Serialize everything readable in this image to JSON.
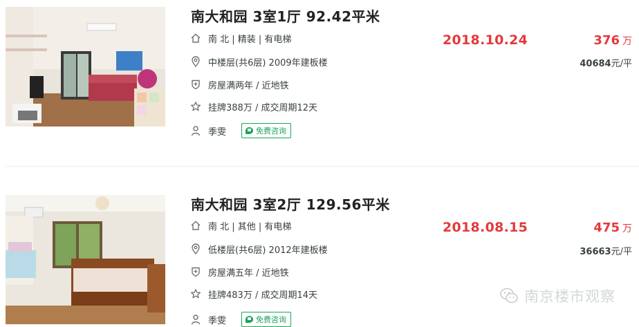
{
  "listings": [
    {
      "title": "南大和园 3室1厅 92.42平米",
      "house_info": "南 北 | 精装 | 有电梯",
      "position_info": "中楼层(共6层) 2009年建板楼",
      "tags": "房屋满两年 / 近地铁",
      "deal_cycle": "挂牌388万 / 成交周期12天",
      "agent": "季雯",
      "consult_label": "免费咨询",
      "deal_date": "2018.10.24",
      "total_price": "376",
      "total_unit": "万",
      "unit_price": "40684",
      "unit_price_suffix": "元/平"
    },
    {
      "title": "南大和园 3室2厅 129.56平米",
      "house_info": "南 北 | 其他 | 有电梯",
      "position_info": "低楼层(共6层) 2012年建板楼",
      "tags": "房屋满五年 / 近地铁",
      "deal_cycle": "挂牌483万 / 成交周期14天",
      "agent": "季雯",
      "consult_label": "免费咨询",
      "deal_date": "2018.08.15",
      "total_price": "475",
      "total_unit": "万",
      "unit_price": "36663",
      "unit_price_suffix": "元/平"
    }
  ],
  "icons": [
    "home-icon",
    "location-pin-icon",
    "shield-check-icon",
    "star-icon",
    "person-icon",
    "chat-bubble-icon",
    "wechat-icon"
  ],
  "colors": {
    "price_red": "#e4393c",
    "consult_green": "#1aa35c",
    "text": "#394043",
    "watermark": "#d3d7d9"
  },
  "watermark": {
    "text": "南京楼市观察"
  }
}
